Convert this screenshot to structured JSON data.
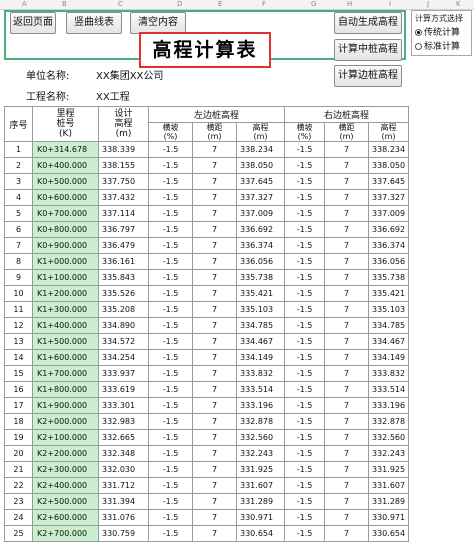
{
  "column_letters": [
    "A",
    "B",
    "C",
    "D",
    "E",
    "F",
    "G",
    "H",
    "I",
    "J",
    "K"
  ],
  "toolbar": {
    "back_label": "返回页面",
    "curve_label": "竖曲线表",
    "clear_label": "清空内容",
    "auto_gen_label": "自动生成高程",
    "calc_center_label": "计算中桩高程",
    "calc_side_label": "计算边桩高程"
  },
  "title": "高程计算表",
  "info": {
    "unit_label": "单位名称:",
    "unit_value": "XX集团XX公司",
    "project_label": "工程名称:",
    "project_value": "XX工程"
  },
  "method_panel": {
    "title": "计算方式选择",
    "options": [
      {
        "label": "传统计算",
        "selected": true
      },
      {
        "label": "标准计算",
        "selected": false
      }
    ]
  },
  "right_cols": {
    "j": "J",
    "k": "K"
  },
  "table": {
    "headers": {
      "seq": "序号",
      "station": "里程\n桩号\n(K)",
      "design": "设计\n高程\n(m)",
      "left_group": "左边桩高程",
      "right_group": "右边桩高程",
      "slope": "横坡\n(%)",
      "dist": "横距\n(m)",
      "elev": "高程\n(m)"
    },
    "rows": [
      {
        "no": "1",
        "st": "K0+314.678",
        "d": "338.339",
        "ls": "-1.5",
        "ld": "7",
        "le": "338.234",
        "rs": "-1.5",
        "rd": "7",
        "re": "338.234"
      },
      {
        "no": "2",
        "st": "K0+400.000",
        "d": "338.155",
        "ls": "-1.5",
        "ld": "7",
        "le": "338.050",
        "rs": "-1.5",
        "rd": "7",
        "re": "338.050"
      },
      {
        "no": "3",
        "st": "K0+500.000",
        "d": "337.750",
        "ls": "-1.5",
        "ld": "7",
        "le": "337.645",
        "rs": "-1.5",
        "rd": "7",
        "re": "337.645"
      },
      {
        "no": "4",
        "st": "K0+600.000",
        "d": "337.432",
        "ls": "-1.5",
        "ld": "7",
        "le": "337.327",
        "rs": "-1.5",
        "rd": "7",
        "re": "337.327"
      },
      {
        "no": "5",
        "st": "K0+700.000",
        "d": "337.114",
        "ls": "-1.5",
        "ld": "7",
        "le": "337.009",
        "rs": "-1.5",
        "rd": "7",
        "re": "337.009"
      },
      {
        "no": "6",
        "st": "K0+800.000",
        "d": "336.797",
        "ls": "-1.5",
        "ld": "7",
        "le": "336.692",
        "rs": "-1.5",
        "rd": "7",
        "re": "336.692"
      },
      {
        "no": "7",
        "st": "K0+900.000",
        "d": "336.479",
        "ls": "-1.5",
        "ld": "7",
        "le": "336.374",
        "rs": "-1.5",
        "rd": "7",
        "re": "336.374"
      },
      {
        "no": "8",
        "st": "K1+000.000",
        "d": "336.161",
        "ls": "-1.5",
        "ld": "7",
        "le": "336.056",
        "rs": "-1.5",
        "rd": "7",
        "re": "336.056"
      },
      {
        "no": "9",
        "st": "K1+100.000",
        "d": "335.843",
        "ls": "-1.5",
        "ld": "7",
        "le": "335.738",
        "rs": "-1.5",
        "rd": "7",
        "re": "335.738"
      },
      {
        "no": "10",
        "st": "K1+200.000",
        "d": "335.526",
        "ls": "-1.5",
        "ld": "7",
        "le": "335.421",
        "rs": "-1.5",
        "rd": "7",
        "re": "335.421"
      },
      {
        "no": "11",
        "st": "K1+300.000",
        "d": "335.208",
        "ls": "-1.5",
        "ld": "7",
        "le": "335.103",
        "rs": "-1.5",
        "rd": "7",
        "re": "335.103"
      },
      {
        "no": "12",
        "st": "K1+400.000",
        "d": "334.890",
        "ls": "-1.5",
        "ld": "7",
        "le": "334.785",
        "rs": "-1.5",
        "rd": "7",
        "re": "334.785"
      },
      {
        "no": "13",
        "st": "K1+500.000",
        "d": "334.572",
        "ls": "-1.5",
        "ld": "7",
        "le": "334.467",
        "rs": "-1.5",
        "rd": "7",
        "re": "334.467"
      },
      {
        "no": "14",
        "st": "K1+600.000",
        "d": "334.254",
        "ls": "-1.5",
        "ld": "7",
        "le": "334.149",
        "rs": "-1.5",
        "rd": "7",
        "re": "334.149"
      },
      {
        "no": "15",
        "st": "K1+700.000",
        "d": "333.937",
        "ls": "-1.5",
        "ld": "7",
        "le": "333.832",
        "rs": "-1.5",
        "rd": "7",
        "re": "333.832"
      },
      {
        "no": "16",
        "st": "K1+800.000",
        "d": "333.619",
        "ls": "-1.5",
        "ld": "7",
        "le": "333.514",
        "rs": "-1.5",
        "rd": "7",
        "re": "333.514"
      },
      {
        "no": "17",
        "st": "K1+900.000",
        "d": "333.301",
        "ls": "-1.5",
        "ld": "7",
        "le": "333.196",
        "rs": "-1.5",
        "rd": "7",
        "re": "333.196"
      },
      {
        "no": "18",
        "st": "K2+000.000",
        "d": "332.983",
        "ls": "-1.5",
        "ld": "7",
        "le": "332.878",
        "rs": "-1.5",
        "rd": "7",
        "re": "332.878"
      },
      {
        "no": "19",
        "st": "K2+100.000",
        "d": "332.665",
        "ls": "-1.5",
        "ld": "7",
        "le": "332.560",
        "rs": "-1.5",
        "rd": "7",
        "re": "332.560"
      },
      {
        "no": "20",
        "st": "K2+200.000",
        "d": "332.348",
        "ls": "-1.5",
        "ld": "7",
        "le": "332.243",
        "rs": "-1.5",
        "rd": "7",
        "re": "332.243"
      },
      {
        "no": "21",
        "st": "K2+300.000",
        "d": "332.030",
        "ls": "-1.5",
        "ld": "7",
        "le": "331.925",
        "rs": "-1.5",
        "rd": "7",
        "re": "331.925"
      },
      {
        "no": "22",
        "st": "K2+400.000",
        "d": "331.712",
        "ls": "-1.5",
        "ld": "7",
        "le": "331.607",
        "rs": "-1.5",
        "rd": "7",
        "re": "331.607"
      },
      {
        "no": "23",
        "st": "K2+500.000",
        "d": "331.394",
        "ls": "-1.5",
        "ld": "7",
        "le": "331.289",
        "rs": "-1.5",
        "rd": "7",
        "re": "331.289"
      },
      {
        "no": "24",
        "st": "K2+600.000",
        "d": "331.076",
        "ls": "-1.5",
        "ld": "7",
        "le": "330.971",
        "rs": "-1.5",
        "rd": "7",
        "re": "330.971"
      },
      {
        "no": "25",
        "st": "K2+700.000",
        "d": "330.759",
        "ls": "-1.5",
        "ld": "7",
        "le": "330.654",
        "rs": "-1.5",
        "rd": "7",
        "re": "330.654"
      }
    ]
  },
  "colors": {
    "station_bg": "#c9efcf",
    "frame": "#4ab07a",
    "title_border": "#e03030"
  }
}
